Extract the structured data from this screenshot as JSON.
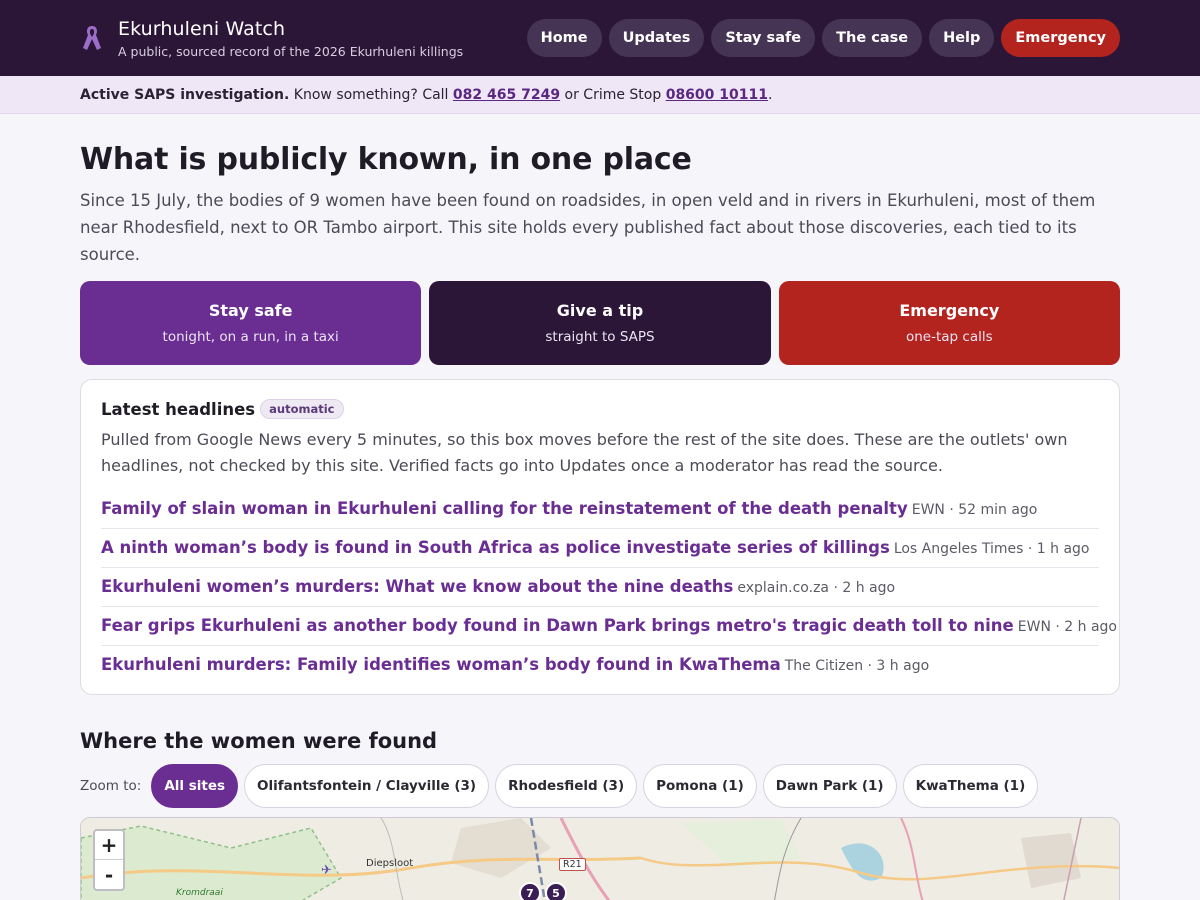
{
  "header": {
    "title": "Ekurhuleni Watch",
    "subtitle": "A public, sourced record of the 2026 Ekurhuleni killings",
    "nav": [
      {
        "label": "Home"
      },
      {
        "label": "Updates"
      },
      {
        "label": "Stay safe"
      },
      {
        "label": "The case"
      },
      {
        "label": "Help"
      },
      {
        "label": "Emergency"
      }
    ],
    "accent": "#2c1638",
    "emergency_color": "#b3241f"
  },
  "notice": {
    "bold": "Active SAPS investigation.",
    "text1": " Know something? Call ",
    "phone": "082 465 7249",
    "text2": " or Crime Stop ",
    "crime_stop": "08600 10111",
    "text3": "."
  },
  "hero": {
    "title": "What is publicly known, in one place",
    "lead": "Since 15 July, the bodies of 9 women have been found on roadsides, in open veld and in rivers in Ekurhuleni, most of them near Rhodesfield, next to OR Tambo airport. This site holds every published fact about those discoveries, each tied to its source."
  },
  "cta": [
    {
      "title": "Stay safe",
      "sub": "tonight, on a run, in a taxi"
    },
    {
      "title": "Give a tip",
      "sub": "straight to SAPS"
    },
    {
      "title": "Emergency",
      "sub": "one-tap calls"
    }
  ],
  "headlines": {
    "title": "Latest headlines",
    "badge": "automatic",
    "desc": "Pulled from Google News every 5 minutes, so this box moves before the rest of the site does. These are the outlets' own headlines, not checked by this site. Verified facts go into Updates once a moderator has read the source.",
    "items": [
      {
        "title": "Family of slain woman in Ekurhuleni calling for the reinstatement of the death penalty",
        "meta": "EWN · 52 min ago"
      },
      {
        "title": "A ninth woman’s body is found in South Africa as police investigate series of killings",
        "meta": "Los Angeles Times · 1 h ago"
      },
      {
        "title": "Ekurhuleni women’s murders: What we know about the nine deaths",
        "meta": "explain.co.za · 2 h ago"
      },
      {
        "title": "Fear grips Ekurhuleni as another body found in Dawn Park brings metro's tragic death toll to nine",
        "meta": "EWN · 2 h ago"
      },
      {
        "title": "Ekurhuleni murders: Family identifies woman’s body found in KwaThema",
        "meta": "The Citizen · 3 h ago"
      }
    ]
  },
  "map_section": {
    "title": "Where the women were found",
    "zoom_label": "Zoom to:",
    "chips": [
      {
        "label": "All sites",
        "active": true
      },
      {
        "label": "Olifantsfontein / Clayville (3)"
      },
      {
        "label": "Rhodesfield (3)"
      },
      {
        "label": "Pomona (1)"
      },
      {
        "label": "Dawn Park (1)"
      },
      {
        "label": "KwaThema (1)"
      }
    ],
    "map": {
      "zoom_in": "+",
      "zoom_out": "-",
      "labels": {
        "diepsloot": "Diepsloot",
        "kromdraai": "Kromdraai",
        "road": "R21"
      },
      "markers": [
        "7",
        "5"
      ]
    }
  }
}
